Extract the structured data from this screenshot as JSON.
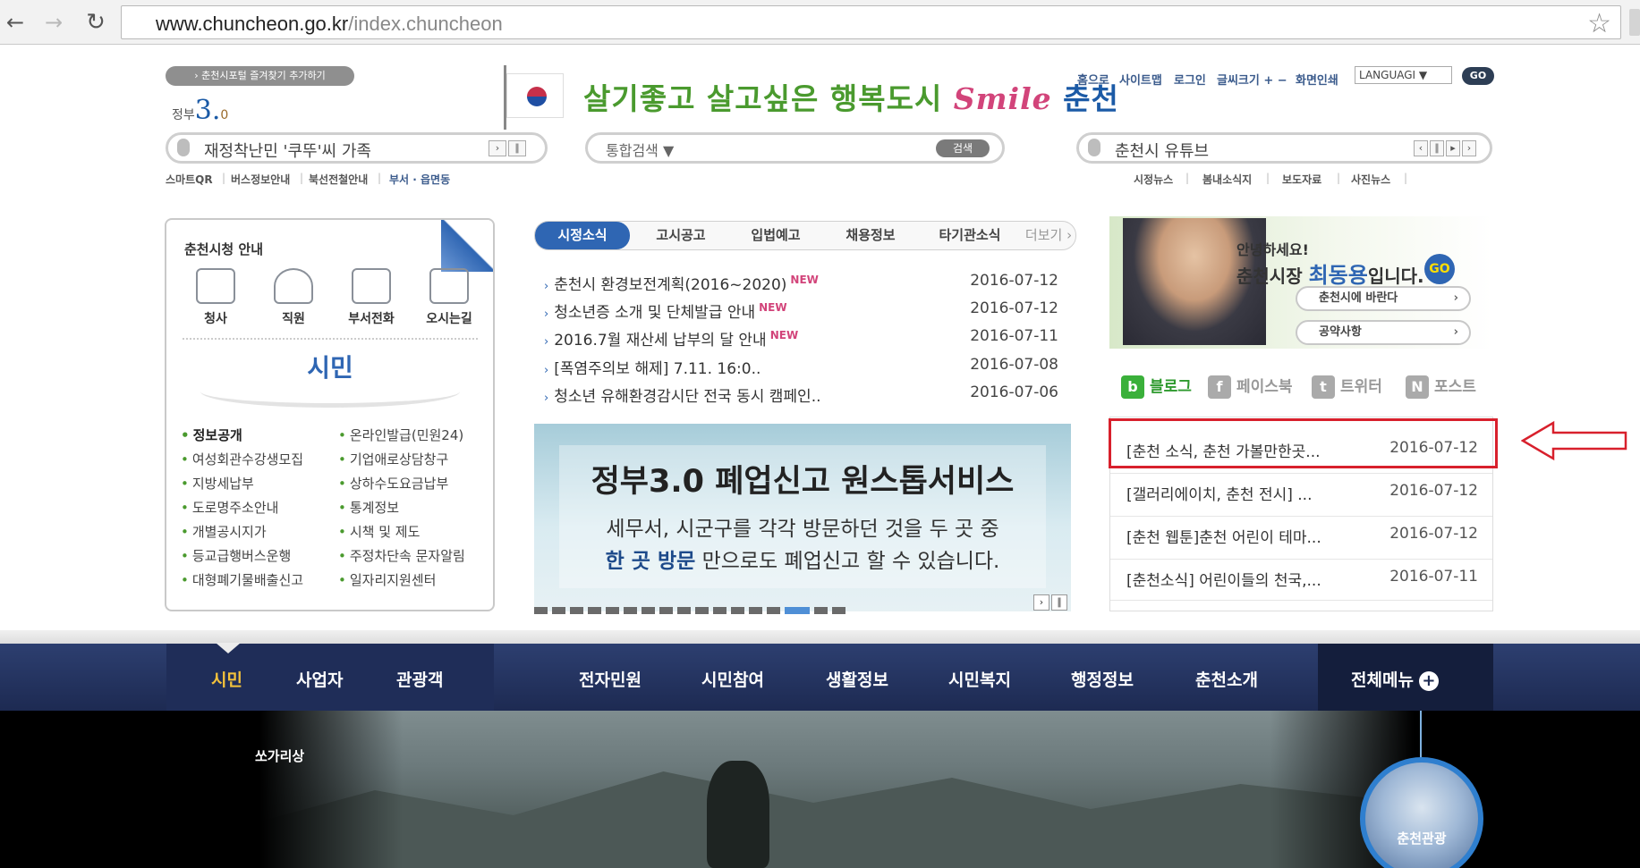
{
  "browser": {
    "url_domain": "www.chuncheon.go.kr",
    "url_path": "/index.chuncheon",
    "back": "←",
    "forward": "→",
    "reload": "↻",
    "star": "☆"
  },
  "header": {
    "favorite_label": "› 춘천시포털 즐겨찾기 추가하기",
    "gov_label": "정부",
    "gov_num": "3.",
    "gov_tail": "0",
    "slogan_main": "살기좋고 살고싶은 행복도시 ",
    "slogan_smile": "Smile",
    "slogan_city": " 춘천",
    "util_links": [
      "홈으로",
      "사이트맵",
      "로그인",
      "글씨크기 + −",
      "화면인쇄"
    ],
    "language": "LANGUAGI ▼",
    "language_go": "GO"
  },
  "tickers": {
    "left_text": "재정착난민 '쿠뚜'씨 가족",
    "right_text": "춘천시 유튜브",
    "search_select": "통합검색  ▼",
    "search_button": "검색"
  },
  "sub_links_left": [
    "스마트QR",
    "버스정보안내",
    "북선전철안내",
    "부서 · 읍면동"
  ],
  "sub_links_right": [
    "시정뉴스",
    "봄내소식지",
    "보도자료",
    "사진뉴스"
  ],
  "left_panel": {
    "title": "춘천시청 안내",
    "guides": [
      "청사",
      "직원",
      "부서전화",
      "오시는길"
    ],
    "citizen": "시민",
    "links_col1": [
      "정보공개",
      "여성회관수강생모집",
      "지방세납부",
      "도로명주소안내",
      "개별공시지가",
      "등교급행버스운행",
      "대형폐기물배출신고"
    ],
    "links_col2": [
      "온라인발급(민원24)",
      "기업애로상담창구",
      "상하수도요금납부",
      "통계정보",
      "시책 및 제도",
      "주정차단속 문자알림",
      "일자리지원센터"
    ]
  },
  "news": {
    "tabs": [
      "시정소식",
      "고시공고",
      "입법예고",
      "채용정보",
      "타기관소식",
      "더보기 ›"
    ],
    "items": [
      {
        "title": "춘천시 환경보전계획(2016~2020)",
        "new": "NEW",
        "date": "2016-07-12"
      },
      {
        "title": "청소년증 소개 및 단체발급 안내",
        "new": "NEW",
        "date": "2016-07-12"
      },
      {
        "title": "2016.7월 재산세 납부의 달 안내",
        "new": "NEW",
        "date": "2016-07-11"
      },
      {
        "title": "[폭염주의보 해제] 7.11. 16:0..",
        "new": "",
        "date": "2016-07-08"
      },
      {
        "title": "청소년 유해환경감시단 전국 동시 캠페인..",
        "new": "",
        "date": "2016-07-06"
      }
    ]
  },
  "banner": {
    "title": "정부3.0 폐업신고 원스톱서비스",
    "line1": "세무서, 시군구를 각각 방문하던 것을 두 곳 중",
    "line2_bold": "한 곳 방문",
    "line2_rest": " 만으로도 폐업신고 할 수 있습니다.",
    "active_dot": 14,
    "dot_count": 17
  },
  "mayor": {
    "hello": "안녕하세요!",
    "name_prefix": "춘천시장 ",
    "name": "최동용",
    "name_suffix": "입니다.",
    "go": "GO",
    "btn1": "춘천시에 바란다",
    "btn2": "공약사항"
  },
  "sns": [
    "블로그",
    "페이스북",
    "트위터",
    "포스트"
  ],
  "blog_items": [
    {
      "title": "[춘천 소식, 춘천 가볼만한곳...",
      "date": "2016-07-12"
    },
    {
      "title": "[갤러리에이치, 춘천 전시] ...",
      "date": "2016-07-12"
    },
    {
      "title": "[춘천 웹툰]춘천 어린이 테마...",
      "date": "2016-07-12"
    },
    {
      "title": "[춘천소식] 어린이들의 천국,...",
      "date": "2016-07-11"
    }
  ],
  "gnb": {
    "left": [
      "시민",
      "사업자",
      "관광객"
    ],
    "center": [
      "전자민원",
      "시민참여",
      "생활정보",
      "시민복지",
      "행정정보",
      "춘천소개"
    ],
    "all_menu": "전체메뉴"
  },
  "hero": {
    "caption": "쏘가리상",
    "tour_label": "춘천관광"
  },
  "colors": {
    "accent": "#2f66b3",
    "gnb": "#1d2a52",
    "highlight": "#d8202c"
  }
}
